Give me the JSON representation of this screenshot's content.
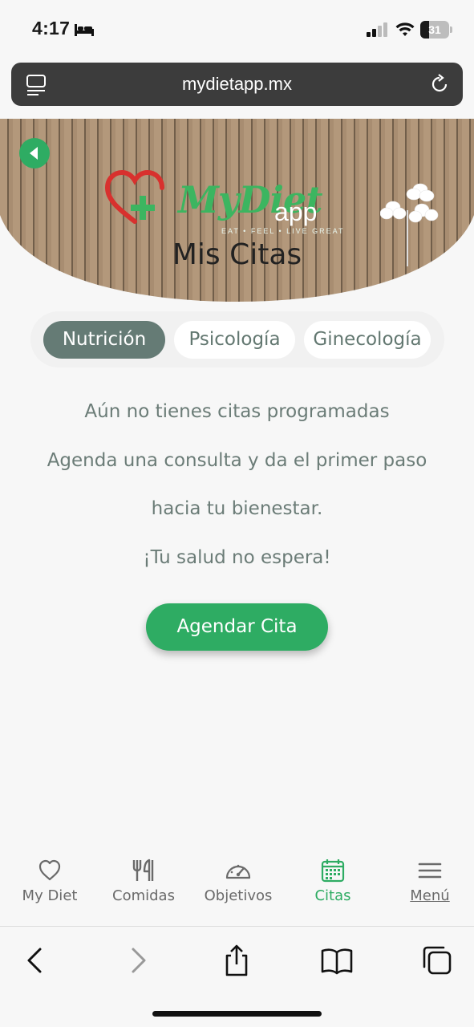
{
  "status_bar": {
    "time": "4:17",
    "battery_level": "31",
    "battery_fraction": 0.31
  },
  "browser": {
    "url": "mydietapp.mx"
  },
  "hero": {
    "logo_name": "MyDiet",
    "logo_suffix": "app",
    "logo_tagline": "EAT • FEEL • LIVE GREAT",
    "title": "Mis Citas"
  },
  "tabs": [
    {
      "label": "Nutrición",
      "active": true
    },
    {
      "label": "Psicología",
      "active": false
    },
    {
      "label": "Ginecología",
      "active": false
    }
  ],
  "message": {
    "line1": "Aún no tienes citas programadas",
    "line2": "Agenda una consulta y da el primer paso",
    "line3": "hacia tu bienestar.",
    "line4": "¡Tu salud no espera!"
  },
  "cta_label": "Agendar Cita",
  "bottom_nav": [
    {
      "label": "My Diet",
      "icon": "heart-icon"
    },
    {
      "label": "Comidas",
      "icon": "fork-knife-icon"
    },
    {
      "label": "Objetivos",
      "icon": "gauge-icon"
    },
    {
      "label": "Citas",
      "icon": "calendar-icon",
      "active": true
    },
    {
      "label": "Menú",
      "icon": "hamburger-icon"
    }
  ],
  "colors": {
    "brand_green": "#2eac63",
    "tab_active": "#657b75",
    "text_muted": "#6b7c77"
  }
}
